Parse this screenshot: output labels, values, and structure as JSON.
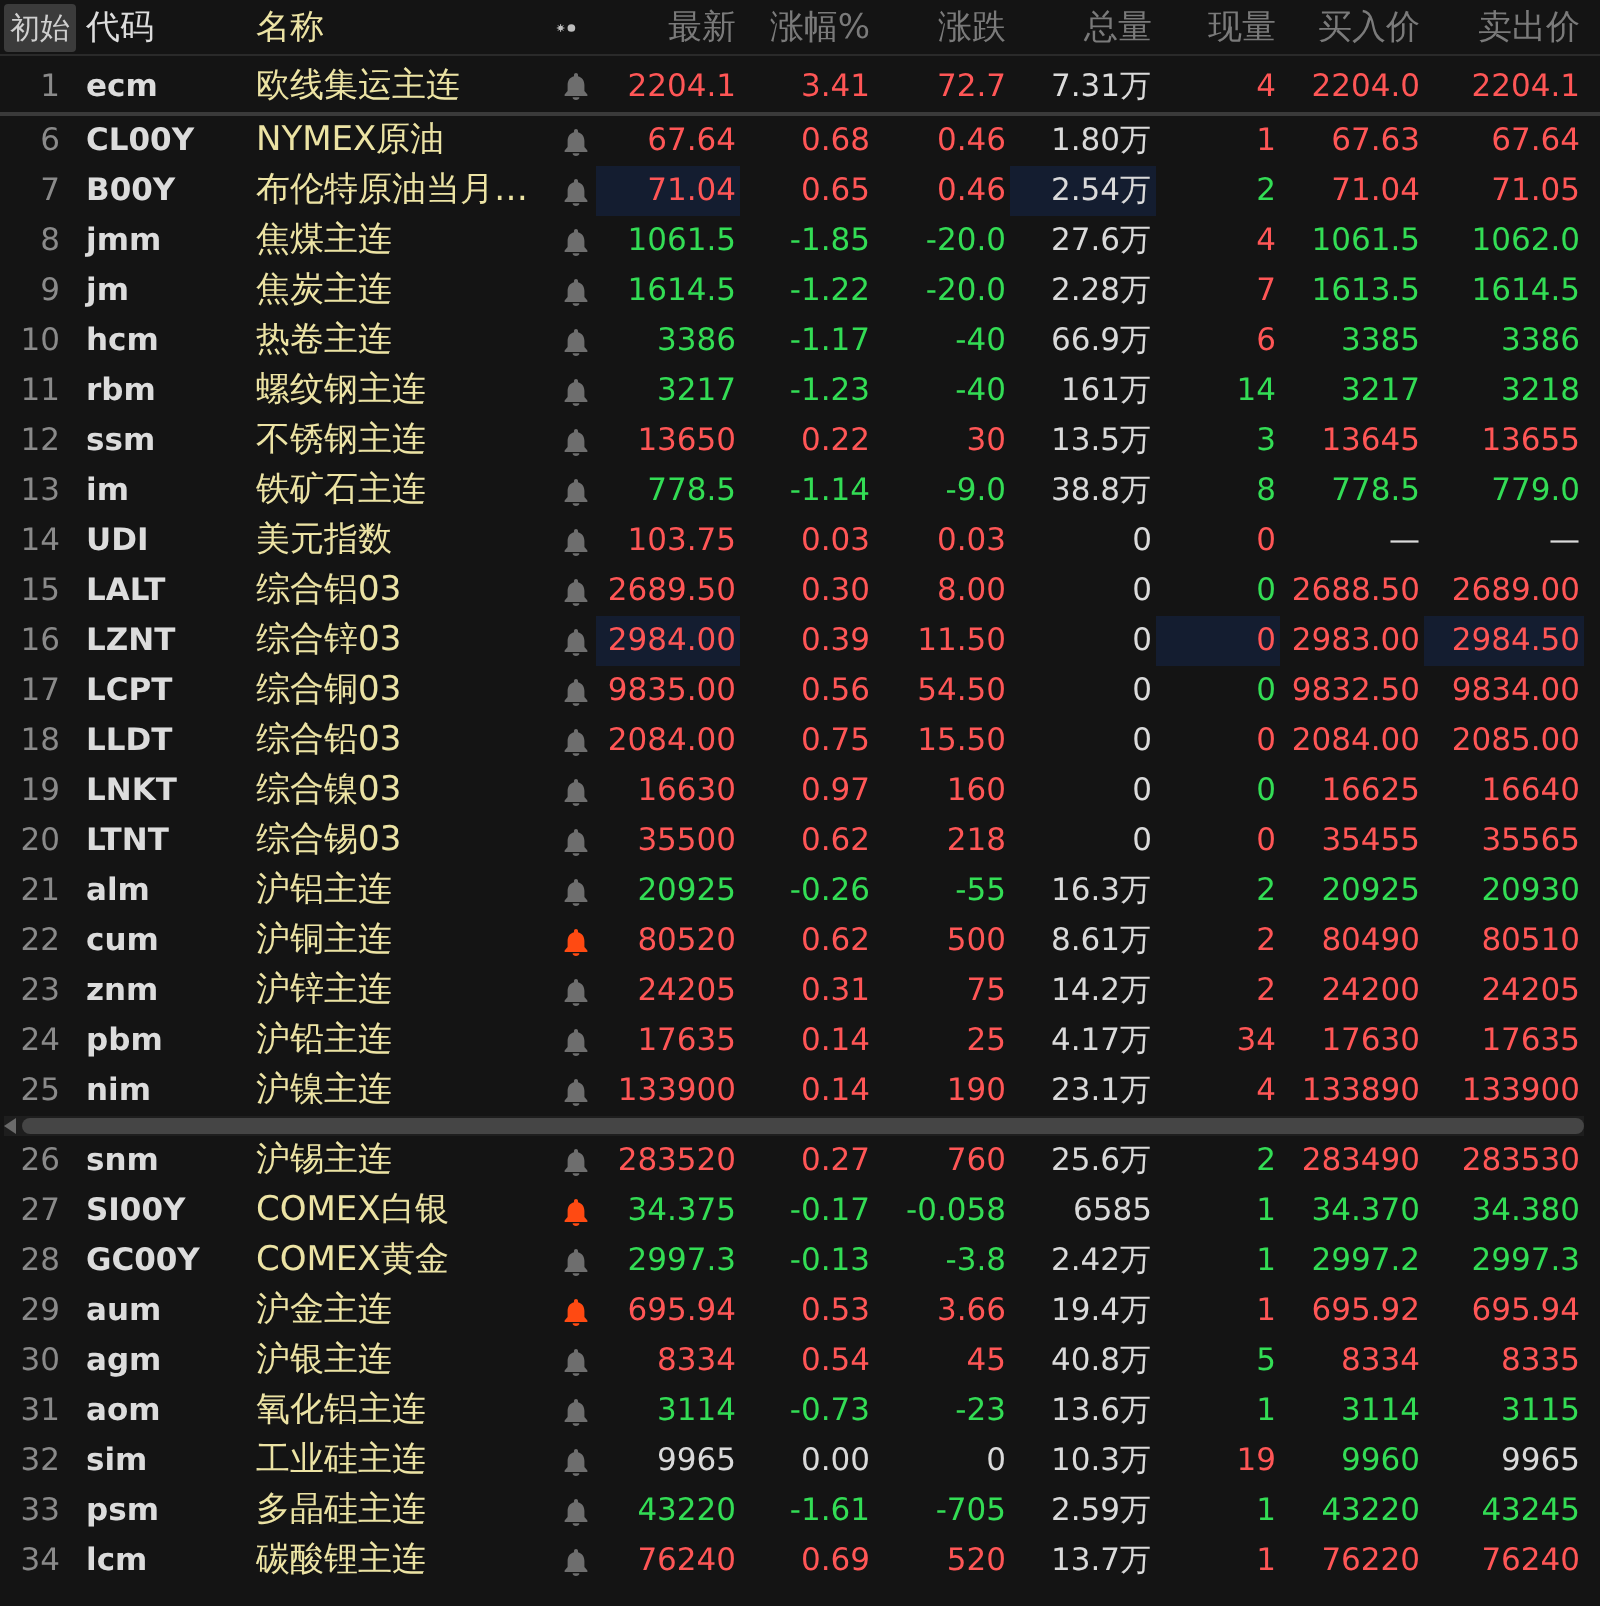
{
  "reset_button": "初始",
  "columns": [
    "代码",
    "名称",
    "最新",
    "涨幅%",
    "涨跌",
    "总量",
    "现量",
    "买入价",
    "卖出价"
  ],
  "pinned_rows": [
    {
      "number": "1",
      "code": "ecm",
      "name": "欧线集运主连",
      "alert": false,
      "cells": [
        {
          "value": "2204.1",
          "color": "#ff5656"
        },
        {
          "value": "3.41",
          "color": "#ff5656"
        },
        {
          "value": "72.7",
          "color": "#ff5656"
        },
        {
          "value": "7.31万",
          "color": "#dadada"
        },
        {
          "value": "4",
          "color": "#ff5656"
        },
        {
          "value": "2204.0",
          "color": "#ff5656"
        },
        {
          "value": "2204.1",
          "color": "#ff5656"
        }
      ]
    }
  ],
  "rows": [
    {
      "number": "6",
      "code": "CL00Y",
      "name": "NYMEX原油",
      "alert": false,
      "cells": [
        {
          "value": "67.64",
          "color": "#ff5656"
        },
        {
          "value": "0.68",
          "color": "#ff5656"
        },
        {
          "value": "0.46",
          "color": "#ff5656"
        },
        {
          "value": "1.80万",
          "color": "#dadada"
        },
        {
          "value": "1",
          "color": "#ff5656"
        },
        {
          "value": "67.63",
          "color": "#ff5656"
        },
        {
          "value": "67.64",
          "color": "#ff5656"
        }
      ]
    },
    {
      "number": "7",
      "code": "B00Y",
      "name": "布伦特原油当月…",
      "alert": false,
      "cells": [
        {
          "value": "71.04",
          "color": "#ff5656",
          "flash": true
        },
        {
          "value": "0.65",
          "color": "#ff5656"
        },
        {
          "value": "0.46",
          "color": "#ff5656"
        },
        {
          "value": "2.54万",
          "color": "#dadada",
          "flash": true
        },
        {
          "value": "2",
          "color": "#33dd55"
        },
        {
          "value": "71.04",
          "color": "#ff5656"
        },
        {
          "value": "71.05",
          "color": "#ff5656"
        }
      ]
    },
    {
      "number": "8",
      "code": "jmm",
      "name": "焦煤主连",
      "alert": false,
      "cells": [
        {
          "value": "1061.5",
          "color": "#33dd55"
        },
        {
          "value": "-1.85",
          "color": "#33dd55"
        },
        {
          "value": "-20.0",
          "color": "#33dd55"
        },
        {
          "value": "27.6万",
          "color": "#dadada"
        },
        {
          "value": "4",
          "color": "#ff5656"
        },
        {
          "value": "1061.5",
          "color": "#33dd55"
        },
        {
          "value": "1062.0",
          "color": "#33dd55"
        }
      ]
    },
    {
      "number": "9",
      "code": "jm",
      "name": "焦炭主连",
      "alert": false,
      "cells": [
        {
          "value": "1614.5",
          "color": "#33dd55"
        },
        {
          "value": "-1.22",
          "color": "#33dd55"
        },
        {
          "value": "-20.0",
          "color": "#33dd55"
        },
        {
          "value": "2.28万",
          "color": "#dadada"
        },
        {
          "value": "7",
          "color": "#ff5656"
        },
        {
          "value": "1613.5",
          "color": "#33dd55"
        },
        {
          "value": "1614.5",
          "color": "#33dd55"
        }
      ]
    },
    {
      "number": "10",
      "code": "hcm",
      "name": "热卷主连",
      "alert": false,
      "cells": [
        {
          "value": "3386",
          "color": "#33dd55"
        },
        {
          "value": "-1.17",
          "color": "#33dd55"
        },
        {
          "value": "-40",
          "color": "#33dd55"
        },
        {
          "value": "66.9万",
          "color": "#dadada"
        },
        {
          "value": "6",
          "color": "#ff5656"
        },
        {
          "value": "3385",
          "color": "#33dd55"
        },
        {
          "value": "3386",
          "color": "#33dd55"
        }
      ]
    },
    {
      "number": "11",
      "code": "rbm",
      "name": "螺纹钢主连",
      "alert": false,
      "cells": [
        {
          "value": "3217",
          "color": "#33dd55"
        },
        {
          "value": "-1.23",
          "color": "#33dd55"
        },
        {
          "value": "-40",
          "color": "#33dd55"
        },
        {
          "value": "161万",
          "color": "#dadada"
        },
        {
          "value": "14",
          "color": "#33dd55"
        },
        {
          "value": "3217",
          "color": "#33dd55"
        },
        {
          "value": "3218",
          "color": "#33dd55"
        }
      ]
    },
    {
      "number": "12",
      "code": "ssm",
      "name": "不锈钢主连",
      "alert": false,
      "cells": [
        {
          "value": "13650",
          "color": "#ff5656"
        },
        {
          "value": "0.22",
          "color": "#ff5656"
        },
        {
          "value": "30",
          "color": "#ff5656"
        },
        {
          "value": "13.5万",
          "color": "#dadada"
        },
        {
          "value": "3",
          "color": "#33dd55"
        },
        {
          "value": "13645",
          "color": "#ff5656"
        },
        {
          "value": "13655",
          "color": "#ff5656"
        }
      ]
    },
    {
      "number": "13",
      "code": "im",
      "name": "铁矿石主连",
      "alert": false,
      "cells": [
        {
          "value": "778.5",
          "color": "#33dd55"
        },
        {
          "value": "-1.14",
          "color": "#33dd55"
        },
        {
          "value": "-9.0",
          "color": "#33dd55"
        },
        {
          "value": "38.8万",
          "color": "#dadada"
        },
        {
          "value": "8",
          "color": "#33dd55"
        },
        {
          "value": "778.5",
          "color": "#33dd55"
        },
        {
          "value": "779.0",
          "color": "#33dd55"
        }
      ]
    },
    {
      "number": "14",
      "code": "UDI",
      "name": "美元指数",
      "alert": false,
      "cells": [
        {
          "value": "103.75",
          "color": "#ff5656"
        },
        {
          "value": "0.03",
          "color": "#ff5656"
        },
        {
          "value": "0.03",
          "color": "#ff5656"
        },
        {
          "value": "0",
          "color": "#dadada"
        },
        {
          "value": "0",
          "color": "#ff5656"
        },
        {
          "value": "—",
          "color": "#dadada"
        },
        {
          "value": "—",
          "color": "#dadada"
        }
      ]
    },
    {
      "number": "15",
      "code": "LALT",
      "name": "综合铝03",
      "alert": false,
      "cells": [
        {
          "value": "2689.50",
          "color": "#ff5656"
        },
        {
          "value": "0.30",
          "color": "#ff5656"
        },
        {
          "value": "8.00",
          "color": "#ff5656"
        },
        {
          "value": "0",
          "color": "#dadada"
        },
        {
          "value": "0",
          "color": "#33dd55"
        },
        {
          "value": "2688.50",
          "color": "#ff5656"
        },
        {
          "value": "2689.00",
          "color": "#ff5656"
        }
      ]
    },
    {
      "number": "16",
      "code": "LZNT",
      "name": "综合锌03",
      "alert": false,
      "cells": [
        {
          "value": "2984.00",
          "color": "#ff5656",
          "flash": true
        },
        {
          "value": "0.39",
          "color": "#ff5656"
        },
        {
          "value": "11.50",
          "color": "#ff5656"
        },
        {
          "value": "0",
          "color": "#dadada"
        },
        {
          "value": "0",
          "color": "#ff5656",
          "flash": true
        },
        {
          "value": "2983.00",
          "color": "#ff5656"
        },
        {
          "value": "2984.50",
          "color": "#ff5656",
          "flash": true
        }
      ]
    },
    {
      "number": "17",
      "code": "LCPT",
      "name": "综合铜03",
      "alert": false,
      "cells": [
        {
          "value": "9835.00",
          "color": "#ff5656"
        },
        {
          "value": "0.56",
          "color": "#ff5656"
        },
        {
          "value": "54.50",
          "color": "#ff5656"
        },
        {
          "value": "0",
          "color": "#dadada"
        },
        {
          "value": "0",
          "color": "#33dd55"
        },
        {
          "value": "9832.50",
          "color": "#ff5656"
        },
        {
          "value": "9834.00",
          "color": "#ff5656"
        }
      ]
    },
    {
      "number": "18",
      "code": "LLDT",
      "name": "综合铅03",
      "alert": false,
      "cells": [
        {
          "value": "2084.00",
          "color": "#ff5656"
        },
        {
          "value": "0.75",
          "color": "#ff5656"
        },
        {
          "value": "15.50",
          "color": "#ff5656"
        },
        {
          "value": "0",
          "color": "#dadada"
        },
        {
          "value": "0",
          "color": "#ff5656"
        },
        {
          "value": "2084.00",
          "color": "#ff5656"
        },
        {
          "value": "2085.00",
          "color": "#ff5656"
        }
      ]
    },
    {
      "number": "19",
      "code": "LNKT",
      "name": "综合镍03",
      "alert": false,
      "cells": [
        {
          "value": "16630",
          "color": "#ff5656"
        },
        {
          "value": "0.97",
          "color": "#ff5656"
        },
        {
          "value": "160",
          "color": "#ff5656"
        },
        {
          "value": "0",
          "color": "#dadada"
        },
        {
          "value": "0",
          "color": "#33dd55"
        },
        {
          "value": "16625",
          "color": "#ff5656"
        },
        {
          "value": "16640",
          "color": "#ff5656"
        }
      ]
    },
    {
      "number": "20",
      "code": "LTNT",
      "name": "综合锡03",
      "alert": false,
      "cells": [
        {
          "value": "35500",
          "color": "#ff5656"
        },
        {
          "value": "0.62",
          "color": "#ff5656"
        },
        {
          "value": "218",
          "color": "#ff5656"
        },
        {
          "value": "0",
          "color": "#dadada"
        },
        {
          "value": "0",
          "color": "#ff5656"
        },
        {
          "value": "35455",
          "color": "#ff5656"
        },
        {
          "value": "35565",
          "color": "#ff5656"
        }
      ]
    },
    {
      "number": "21",
      "code": "alm",
      "name": "沪铝主连",
      "alert": false,
      "cells": [
        {
          "value": "20925",
          "color": "#33dd55"
        },
        {
          "value": "-0.26",
          "color": "#33dd55"
        },
        {
          "value": "-55",
          "color": "#33dd55"
        },
        {
          "value": "16.3万",
          "color": "#dadada"
        },
        {
          "value": "2",
          "color": "#33dd55"
        },
        {
          "value": "20925",
          "color": "#33dd55"
        },
        {
          "value": "20930",
          "color": "#33dd55"
        }
      ]
    },
    {
      "number": "22",
      "code": "cum",
      "name": "沪铜主连",
      "alert": true,
      "cells": [
        {
          "value": "80520",
          "color": "#ff5656"
        },
        {
          "value": "0.62",
          "color": "#ff5656"
        },
        {
          "value": "500",
          "color": "#ff5656"
        },
        {
          "value": "8.61万",
          "color": "#dadada"
        },
        {
          "value": "2",
          "color": "#ff5656"
        },
        {
          "value": "80490",
          "color": "#ff5656"
        },
        {
          "value": "80510",
          "color": "#ff5656"
        }
      ]
    },
    {
      "number": "23",
      "code": "znm",
      "name": "沪锌主连",
      "alert": false,
      "cells": [
        {
          "value": "24205",
          "color": "#ff5656"
        },
        {
          "value": "0.31",
          "color": "#ff5656"
        },
        {
          "value": "75",
          "color": "#ff5656"
        },
        {
          "value": "14.2万",
          "color": "#dadada"
        },
        {
          "value": "2",
          "color": "#ff5656"
        },
        {
          "value": "24200",
          "color": "#ff5656"
        },
        {
          "value": "24205",
          "color": "#ff5656"
        }
      ]
    },
    {
      "number": "24",
      "code": "pbm",
      "name": "沪铅主连",
      "alert": false,
      "cells": [
        {
          "value": "17635",
          "color": "#ff5656"
        },
        {
          "value": "0.14",
          "color": "#ff5656"
        },
        {
          "value": "25",
          "color": "#ff5656"
        },
        {
          "value": "4.17万",
          "color": "#dadada"
        },
        {
          "value": "34",
          "color": "#ff5656"
        },
        {
          "value": "17630",
          "color": "#ff5656"
        },
        {
          "value": "17635",
          "color": "#ff5656"
        }
      ]
    },
    {
      "number": "25",
      "code": "nim",
      "name": "沪镍主连",
      "alert": false,
      "cells": [
        {
          "value": "133900",
          "color": "#ff5656"
        },
        {
          "value": "0.14",
          "color": "#ff5656"
        },
        {
          "value": "190",
          "color": "#ff5656"
        },
        {
          "value": "23.1万",
          "color": "#dadada"
        },
        {
          "value": "4",
          "color": "#ff5656"
        },
        {
          "value": "133890",
          "color": "#ff5656"
        },
        {
          "value": "133900",
          "color": "#ff5656"
        }
      ]
    }
  ],
  "lower_rows": [
    {
      "number": "26",
      "code": "snm",
      "name": "沪锡主连",
      "alert": false,
      "cells": [
        {
          "value": "283520",
          "color": "#ff5656"
        },
        {
          "value": "0.27",
          "color": "#ff5656"
        },
        {
          "value": "760",
          "color": "#ff5656"
        },
        {
          "value": "25.6万",
          "color": "#dadada"
        },
        {
          "value": "2",
          "color": "#33dd55"
        },
        {
          "value": "283490",
          "color": "#ff5656"
        },
        {
          "value": "283530",
          "color": "#ff5656"
        }
      ]
    },
    {
      "number": "27",
      "code": "SI00Y",
      "name": "COMEX白银",
      "alert": true,
      "cells": [
        {
          "value": "34.375",
          "color": "#33dd55"
        },
        {
          "value": "-0.17",
          "color": "#33dd55"
        },
        {
          "value": "-0.058",
          "color": "#33dd55"
        },
        {
          "value": "6585",
          "color": "#dadada"
        },
        {
          "value": "1",
          "color": "#33dd55"
        },
        {
          "value": "34.370",
          "color": "#33dd55"
        },
        {
          "value": "34.380",
          "color": "#33dd55"
        }
      ]
    },
    {
      "number": "28",
      "code": "GC00Y",
      "name": "COMEX黄金",
      "alert": false,
      "cells": [
        {
          "value": "2997.3",
          "color": "#33dd55"
        },
        {
          "value": "-0.13",
          "color": "#33dd55"
        },
        {
          "value": "-3.8",
          "color": "#33dd55"
        },
        {
          "value": "2.42万",
          "color": "#dadada"
        },
        {
          "value": "1",
          "color": "#33dd55"
        },
        {
          "value": "2997.2",
          "color": "#33dd55"
        },
        {
          "value": "2997.3",
          "color": "#33dd55"
        }
      ]
    },
    {
      "number": "29",
      "code": "aum",
      "name": "沪金主连",
      "alert": true,
      "cells": [
        {
          "value": "695.94",
          "color": "#ff5656"
        },
        {
          "value": "0.53",
          "color": "#ff5656"
        },
        {
          "value": "3.66",
          "color": "#ff5656"
        },
        {
          "value": "19.4万",
          "color": "#dadada"
        },
        {
          "value": "1",
          "color": "#ff5656"
        },
        {
          "value": "695.92",
          "color": "#ff5656"
        },
        {
          "value": "695.94",
          "color": "#ff5656"
        }
      ]
    },
    {
      "number": "30",
      "code": "agm",
      "name": "沪银主连",
      "alert": false,
      "cells": [
        {
          "value": "8334",
          "color": "#ff5656"
        },
        {
          "value": "0.54",
          "color": "#ff5656"
        },
        {
          "value": "45",
          "color": "#ff5656"
        },
        {
          "value": "40.8万",
          "color": "#dadada"
        },
        {
          "value": "5",
          "color": "#33dd55"
        },
        {
          "value": "8334",
          "color": "#ff5656"
        },
        {
          "value": "8335",
          "color": "#ff5656"
        }
      ]
    },
    {
      "number": "31",
      "code": "aom",
      "name": "氧化铝主连",
      "alert": false,
      "cells": [
        {
          "value": "3114",
          "color": "#33dd55"
        },
        {
          "value": "-0.73",
          "color": "#33dd55"
        },
        {
          "value": "-23",
          "color": "#33dd55"
        },
        {
          "value": "13.6万",
          "color": "#dadada"
        },
        {
          "value": "1",
          "color": "#33dd55"
        },
        {
          "value": "3114",
          "color": "#33dd55"
        },
        {
          "value": "3115",
          "color": "#33dd55"
        }
      ]
    },
    {
      "number": "32",
      "code": "sim",
      "name": "工业硅主连",
      "alert": false,
      "cells": [
        {
          "value": "9965",
          "color": "#dadada"
        },
        {
          "value": "0.00",
          "color": "#dadada"
        },
        {
          "value": "0",
          "color": "#dadada"
        },
        {
          "value": "10.3万",
          "color": "#dadada"
        },
        {
          "value": "19",
          "color": "#ff5656"
        },
        {
          "value": "9960",
          "color": "#33dd55"
        },
        {
          "value": "9965",
          "color": "#dadada"
        }
      ]
    },
    {
      "number": "33",
      "code": "psm",
      "name": "多晶硅主连",
      "alert": false,
      "cells": [
        {
          "value": "43220",
          "color": "#33dd55"
        },
        {
          "value": "-1.61",
          "color": "#33dd55"
        },
        {
          "value": "-705",
          "color": "#33dd55"
        },
        {
          "value": "2.59万",
          "color": "#dadada"
        },
        {
          "value": "1",
          "color": "#33dd55"
        },
        {
          "value": "43220",
          "color": "#33dd55"
        },
        {
          "value": "43245",
          "color": "#33dd55"
        }
      ]
    },
    {
      "number": "34",
      "code": "lcm",
      "name": "碳酸锂主连",
      "alert": false,
      "cells": [
        {
          "value": "76240",
          "color": "#ff5656"
        },
        {
          "value": "0.69",
          "color": "#ff5656"
        },
        {
          "value": "520",
          "color": "#ff5656"
        },
        {
          "value": "13.7万",
          "color": "#dadada"
        },
        {
          "value": "1",
          "color": "#ff5656"
        },
        {
          "value": "76220",
          "color": "#ff5656"
        },
        {
          "value": "76240",
          "color": "#ff5656"
        }
      ]
    }
  ]
}
